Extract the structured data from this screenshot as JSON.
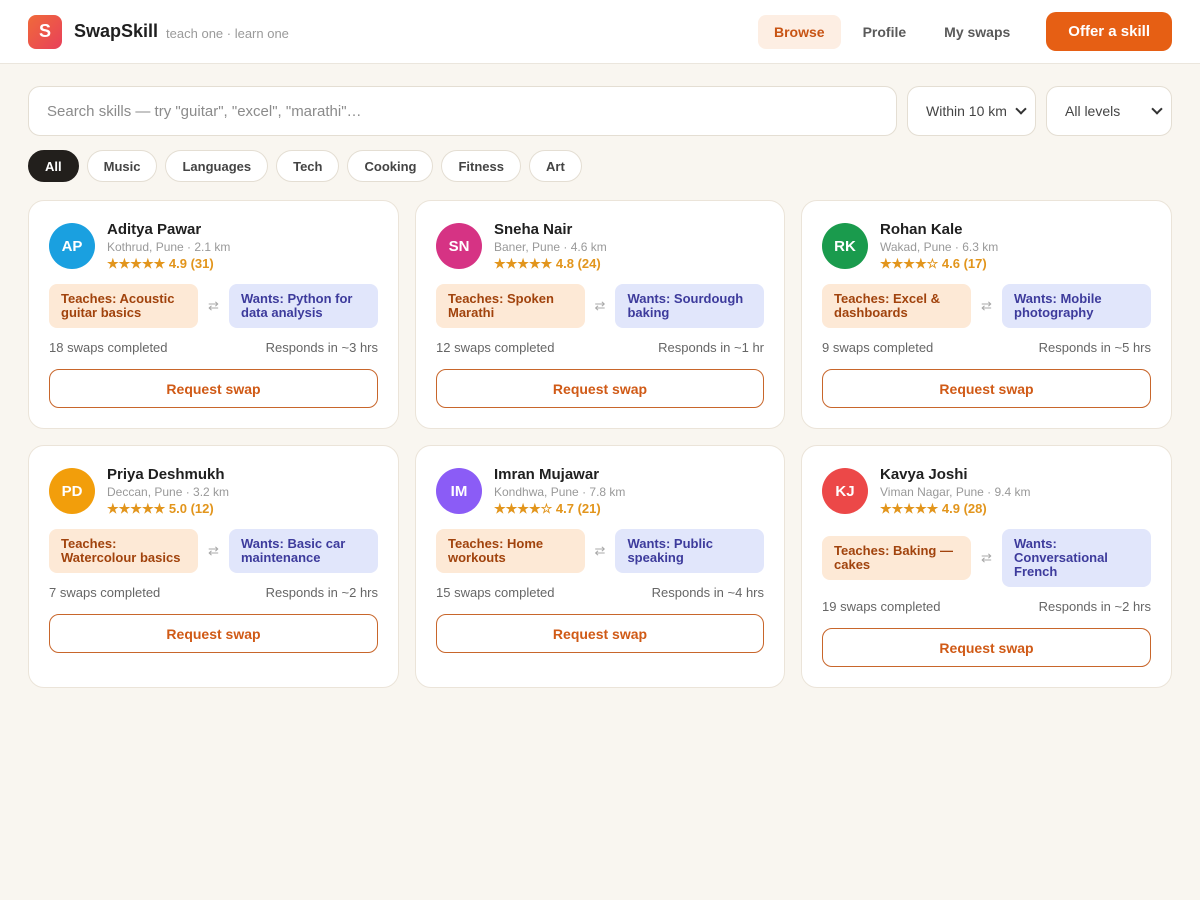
{
  "header": {
    "logo_letter": "S",
    "brand": "SwapSkill",
    "tagline": "teach one · learn one",
    "nav": [
      "Browse",
      "Profile",
      "My swaps"
    ],
    "cta": "Offer a skill"
  },
  "search": {
    "placeholder": "Search skills — try \"guitar\", \"excel\", \"marathi\"…",
    "distance": "Within 10 km",
    "level": "All levels"
  },
  "chips": [
    "All",
    "Music",
    "Languages",
    "Tech",
    "Cooking",
    "Fitness",
    "Art"
  ],
  "cards": [
    {
      "initials": "AP",
      "color": "#1aa0e0",
      "name": "Aditya Pawar",
      "location": "Kothrud, Pune · 2.1 km",
      "rating": "★★★★★ 4.9 (31)",
      "teaches": "Teaches: Acoustic guitar basics",
      "wants": "Wants: Python for data analysis",
      "swaps": "18 swaps completed",
      "responds": "Responds in ~3 hrs",
      "button": "Request swap"
    },
    {
      "initials": "SN",
      "color": "#d63384",
      "name": "Sneha Nair",
      "location": "Baner, Pune · 4.6 km",
      "rating": "★★★★★ 4.8 (24)",
      "teaches": "Teaches: Spoken Marathi",
      "wants": "Wants: Sourdough baking",
      "swaps": "12 swaps completed",
      "responds": "Responds in ~1 hr",
      "button": "Request swap"
    },
    {
      "initials": "RK",
      "color": "#1a9b4d",
      "name": "Rohan Kale",
      "location": "Wakad, Pune · 6.3 km",
      "rating": "★★★★☆ 4.6 (17)",
      "teaches": "Teaches: Excel & dashboards",
      "wants": "Wants: Mobile photography",
      "swaps": "9 swaps completed",
      "responds": "Responds in ~5 hrs",
      "button": "Request swap"
    },
    {
      "initials": "PD",
      "color": "#f29e0b",
      "name": "Priya Deshmukh",
      "location": "Deccan, Pune · 3.2 km",
      "rating": "★★★★★ 5.0 (12)",
      "teaches": "Teaches: Watercolour basics",
      "wants": "Wants: Basic car maintenance",
      "swaps": "7 swaps completed",
      "responds": "Responds in ~2 hrs",
      "button": "Request swap"
    },
    {
      "initials": "IM",
      "color": "#8b5cf6",
      "name": "Imran Mujawar",
      "location": "Kondhwa, Pune · 7.8 km",
      "rating": "★★★★☆ 4.7 (21)",
      "teaches": "Teaches: Home workouts",
      "wants": "Wants: Public speaking",
      "swaps": "15 swaps completed",
      "responds": "Responds in ~4 hrs",
      "button": "Request swap"
    },
    {
      "initials": "KJ",
      "color": "#ec4848",
      "name": "Kavya Joshi",
      "location": "Viman Nagar, Pune · 9.4 km",
      "rating": "★★★★★ 4.9 (28)",
      "teaches": "Teaches: Baking — cakes",
      "wants": "Wants: Conversational French",
      "swaps": "19 swaps completed",
      "responds": "Responds in ~2 hrs",
      "button": "Request swap"
    }
  ]
}
